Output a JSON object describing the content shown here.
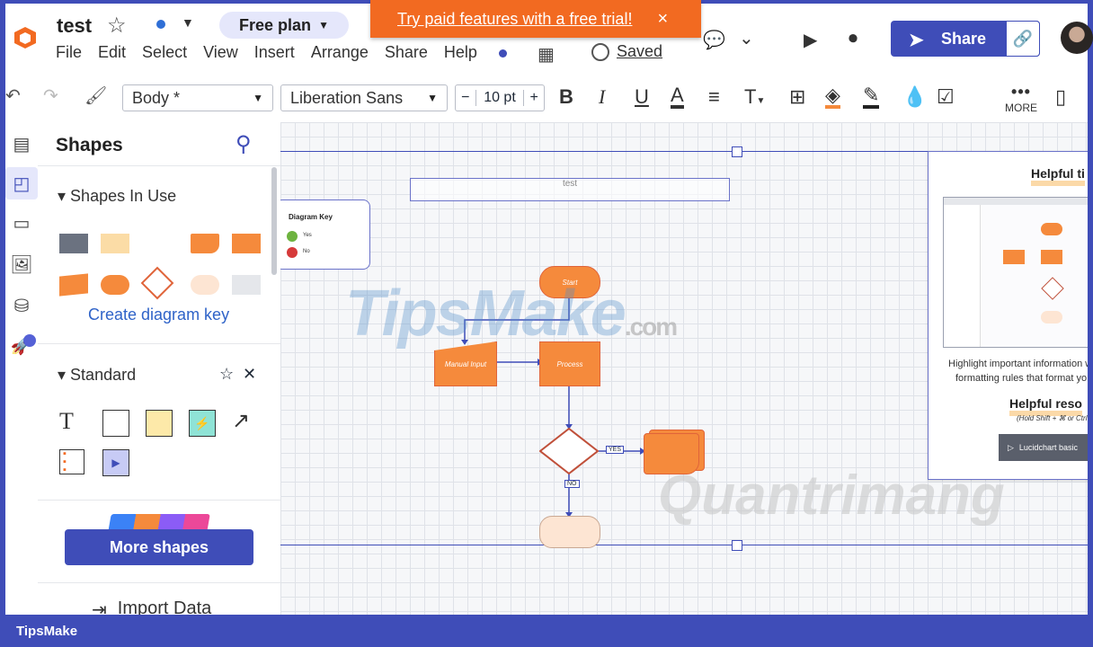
{
  "header": {
    "doc_title": "test",
    "plan_label": "Free plan",
    "menu": [
      "File",
      "Edit",
      "Select",
      "View",
      "Insert",
      "Arrange",
      "Share",
      "Help"
    ],
    "saved_label": "Saved",
    "share_label": "Share",
    "banner_text": "Try paid features with a free trial!",
    "banner_close": "×"
  },
  "toolbar": {
    "style_select": "Body *",
    "font_select": "Liberation Sans",
    "font_size": "10 pt",
    "minus": "−",
    "plus": "+",
    "bold": "B",
    "italic": "I",
    "underline": "U",
    "font_color": "A",
    "text_options": "T",
    "more_label": "MORE"
  },
  "panel": {
    "title": "Shapes",
    "section_in_use": "Shapes In Use",
    "create_key": "Create diagram key",
    "section_standard": "Standard",
    "more_shapes": "More shapes",
    "import_data": "Import Data"
  },
  "canvas": {
    "title_box": "test",
    "title_sub": "",
    "key_title": "Diagram Key",
    "key_items": [
      "Yes",
      "No"
    ],
    "start_label": "Start",
    "manual_input_label": "Manual Input",
    "process_label": "Process",
    "yes_label": "YES",
    "no_label": "NO",
    "card_heading": "Helpful ti",
    "card_text_1": "Highlight important information w",
    "card_text_2": "formatting rules that format yo",
    "card_heading_2": "Helpful reso",
    "card_shortcut": "(Hold Shift + ⌘ or Ctrl",
    "card_video": "Lucidchart basic"
  },
  "watermarks": {
    "tipsmake": "TipsMake",
    "com": ".com",
    "quantrimang": "Quantrimang"
  },
  "footer": {
    "brand": "TipsMake"
  },
  "colors": {
    "accent": "#3f4db8",
    "orange": "#f58a3c",
    "banner": "#f26a21"
  },
  "icons": [
    "star-icon",
    "grid-icon",
    "clock-icon",
    "comment-icon",
    "chevron-down-icon",
    "present-icon",
    "video-icon",
    "paper-plane-icon",
    "link-icon",
    "undo-icon",
    "redo-icon",
    "format-painter-icon",
    "search-icon",
    "close-icon"
  ]
}
